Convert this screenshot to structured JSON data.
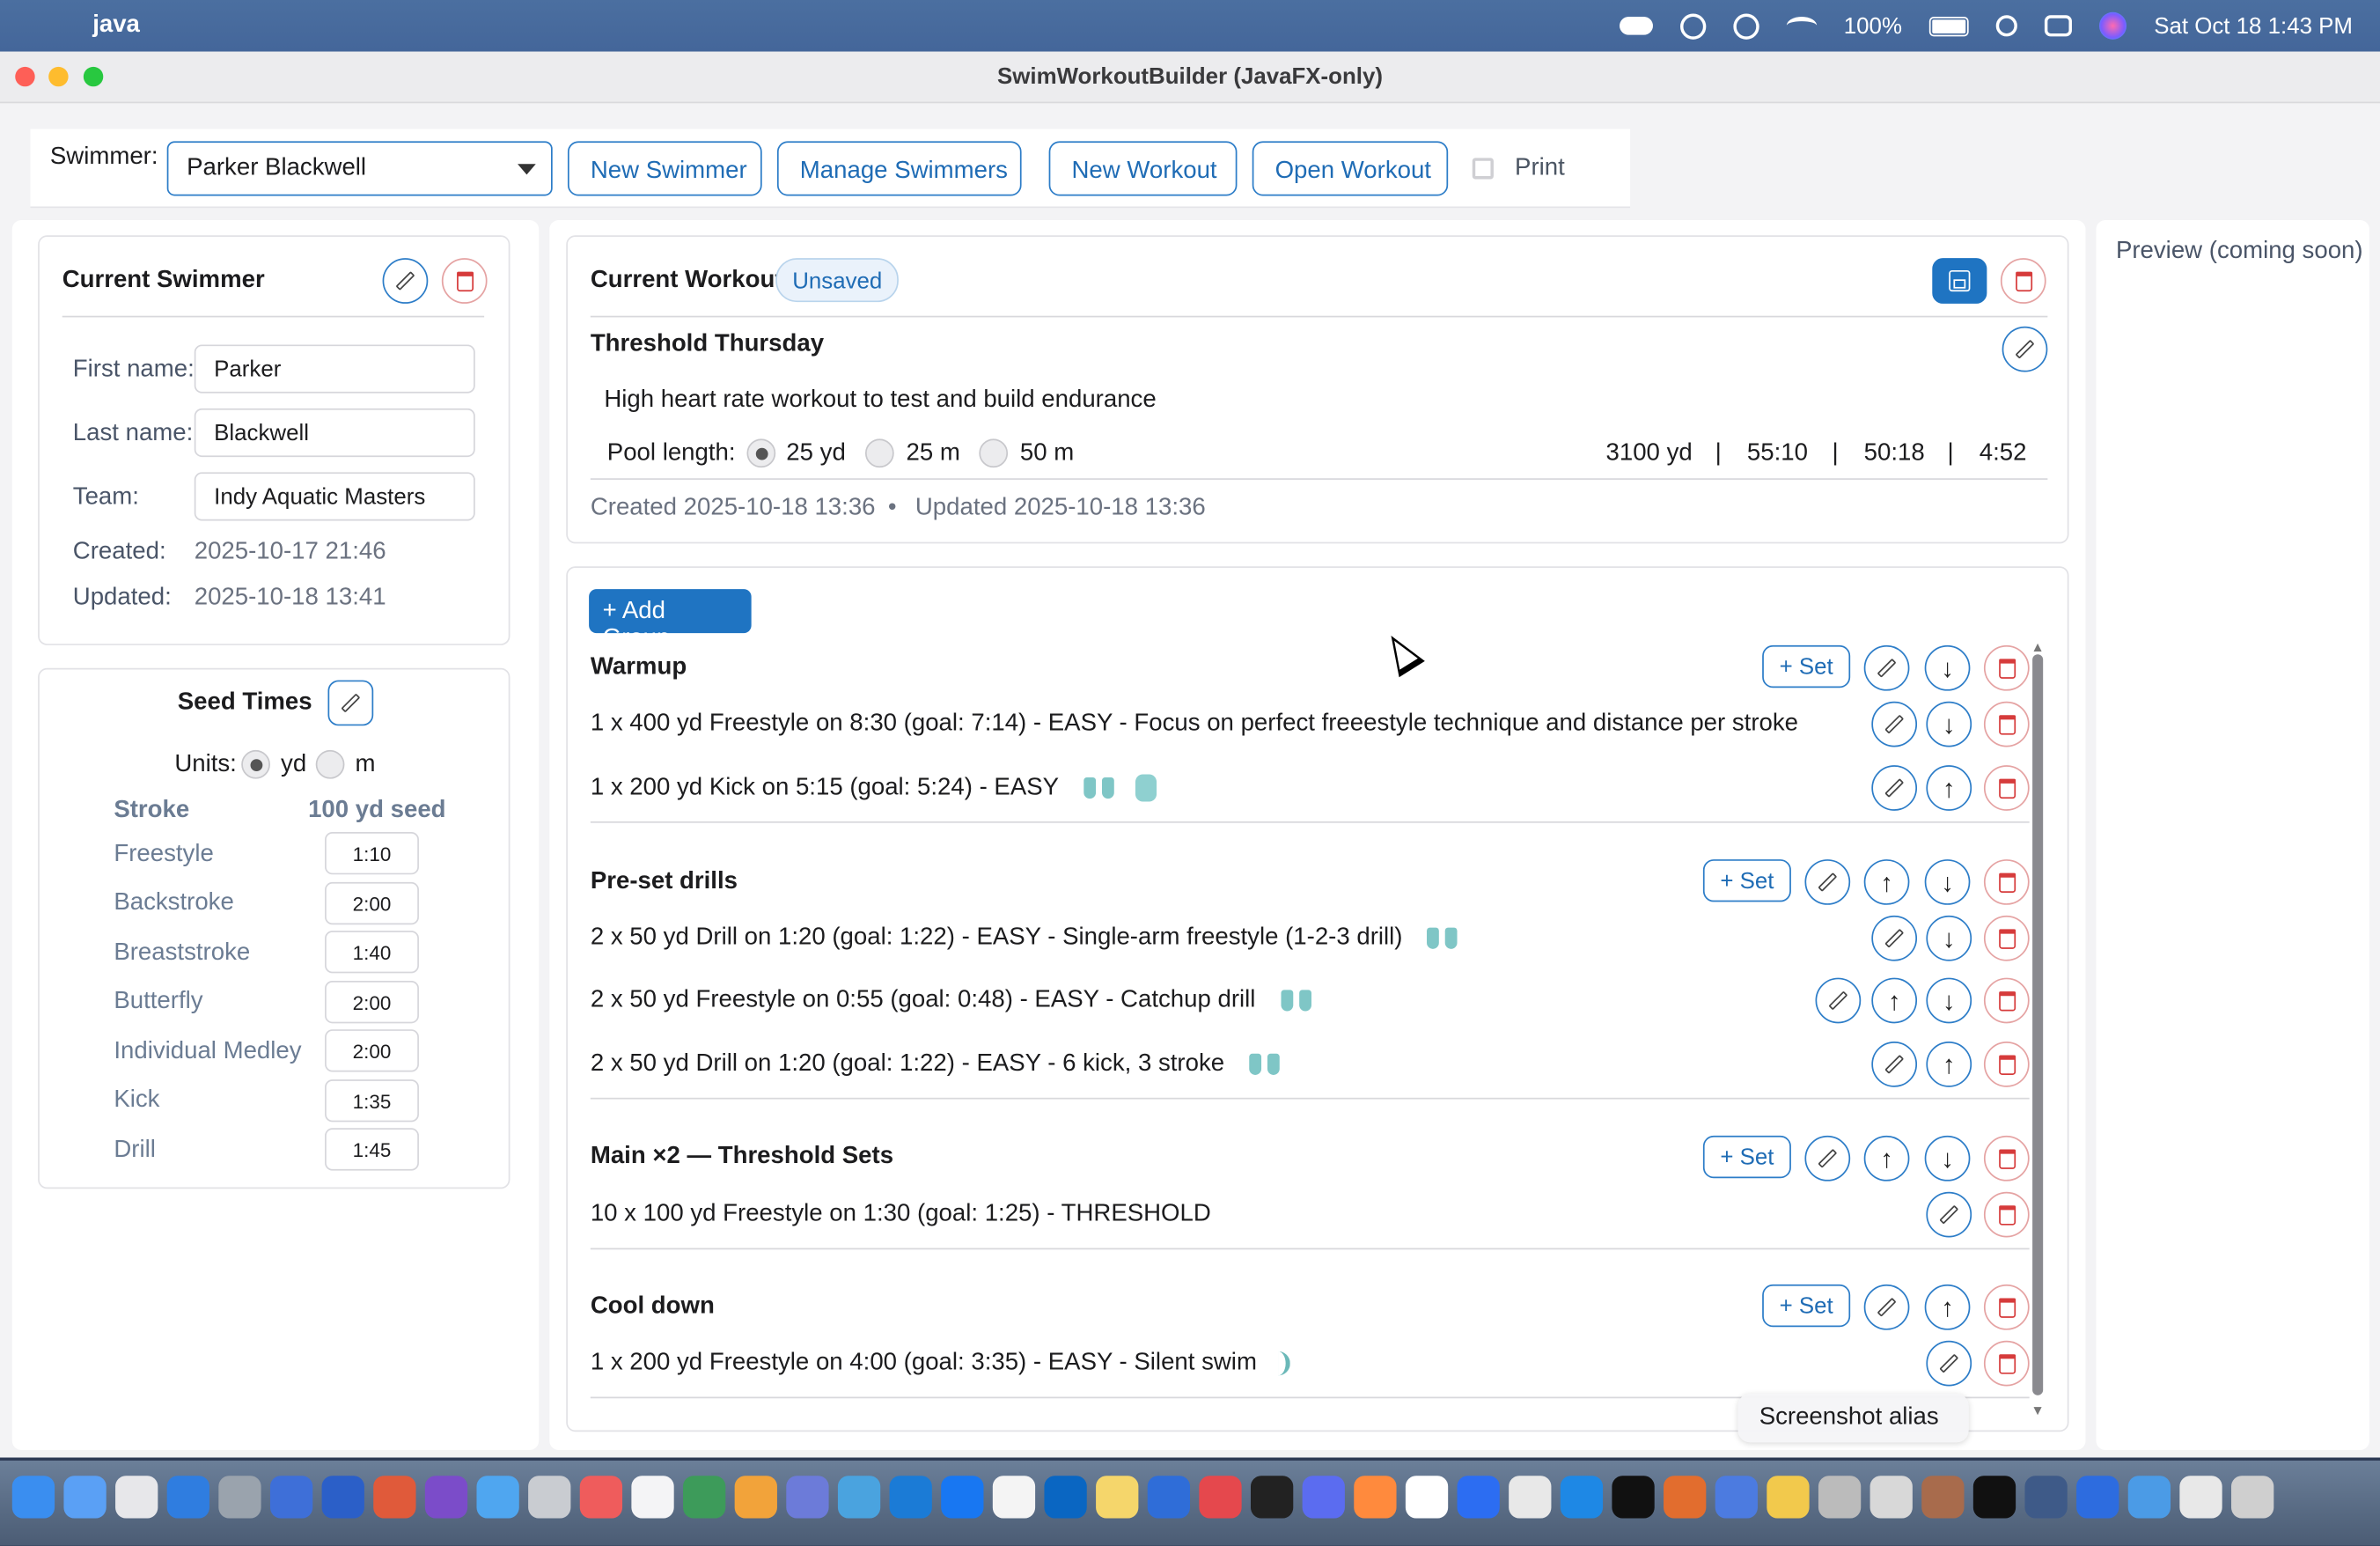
{
  "menubar": {
    "app_name": "java",
    "battery": "100%",
    "datetime": "Sat Oct 18  1:43 PM"
  },
  "window": {
    "title": "SwimWorkoutBuilder (JavaFX-only)"
  },
  "toolbar": {
    "swimmer_label": "Swimmer:",
    "swimmer_selected": "Parker Blackwell",
    "new_swimmer": "New Swimmer",
    "manage_swimmers": "Manage Swimmers",
    "new_workout": "New Workout",
    "open_workout": "Open Workout",
    "print": "Print"
  },
  "swimmer": {
    "title": "Current Swimmer",
    "first_name_label": "First name:",
    "first_name": "Parker",
    "last_name_label": "Last name:",
    "last_name": "Blackwell",
    "team_label": "Team:",
    "team": "Indy Aquatic Masters",
    "created_label": "Created:",
    "created": "2025-10-17 21:46",
    "updated_label": "Updated:",
    "updated": "2025-10-18 13:41"
  },
  "seed": {
    "title": "Seed Times",
    "units_label": "Units:",
    "unit_yd": "yd",
    "unit_m": "m",
    "selected_unit": "yd",
    "col_stroke": "Stroke",
    "col_seed": "100 yd seed",
    "rows": [
      {
        "stroke": "Freestyle",
        "time": "1:10"
      },
      {
        "stroke": "Backstroke",
        "time": "2:00"
      },
      {
        "stroke": "Breaststroke",
        "time": "1:40"
      },
      {
        "stroke": "Butterfly",
        "time": "2:00"
      },
      {
        "stroke": "Individual Medley",
        "time": "2:00"
      },
      {
        "stroke": "Kick",
        "time": "1:35"
      },
      {
        "stroke": "Drill",
        "time": "1:45"
      }
    ]
  },
  "workout": {
    "title": "Current Workout",
    "status": "Unsaved",
    "name": "Threshold Thursday",
    "description": "High heart rate workout to test and build endurance",
    "pool_length_label": "Pool length:",
    "pool_options": [
      "25 yd",
      "25 m",
      "50 m"
    ],
    "pool_selected": "25 yd",
    "stats": {
      "distance": "3100 yd",
      "time1": "55:10",
      "time2": "50:18",
      "pace": "4:52"
    },
    "stat_sep": "|",
    "created": "Created 2025-10-18 13:36",
    "meta_sep": "•",
    "updated": "Updated 2025-10-18 13:36"
  },
  "groups_panel": {
    "add_group": "+ Add Group",
    "add_set": "+ Set",
    "groups": [
      {
        "name": "Warmup",
        "sets": [
          {
            "text": "1 x 400 yd Freestyle on 8:30 (goal: 7:14) - EASY  - Focus on perfect freeestyle technique and distance per stroke"
          },
          {
            "text": "1 x 200 yd Kick on 5:15 (goal: 5:24) - EASY"
          }
        ]
      },
      {
        "name": "Pre-set drills",
        "sets": [
          {
            "text": "2 x 50 yd Drill on 1:20 (goal: 1:22) - EASY  - Single-arm freestyle (1-2-3 drill)"
          },
          {
            "text": "2 x 50 yd Freestyle on 0:55 (goal: 0:48) - EASY  - Catchup drill"
          },
          {
            "text": "2 x 50 yd Drill on 1:20 (goal: 1:22) - EASY  - 6 kick, 3 stroke"
          }
        ]
      },
      {
        "name": "Main ×2 — Threshold Sets",
        "sets": [
          {
            "text": "10 x 100 yd Freestyle on 1:30 (goal: 1:25) - THRESHOLD"
          }
        ]
      },
      {
        "name": "Cool down",
        "sets": [
          {
            "text": "1 x 200 yd Freestyle on 4:00 (goal: 3:35) - EASY  - Silent swim"
          }
        ]
      }
    ]
  },
  "preview": {
    "label": "Preview (coming soon)"
  },
  "tooltip": {
    "text": "Screenshot alias"
  },
  "icons": {
    "fins": "fins-icon",
    "buoy": "pull-buoy-icon",
    "snorkel": "snorkel-icon"
  },
  "colors": {
    "accent": "#1f74c2",
    "danger": "#d63b3b",
    "equipment": "#7fc6c6"
  }
}
